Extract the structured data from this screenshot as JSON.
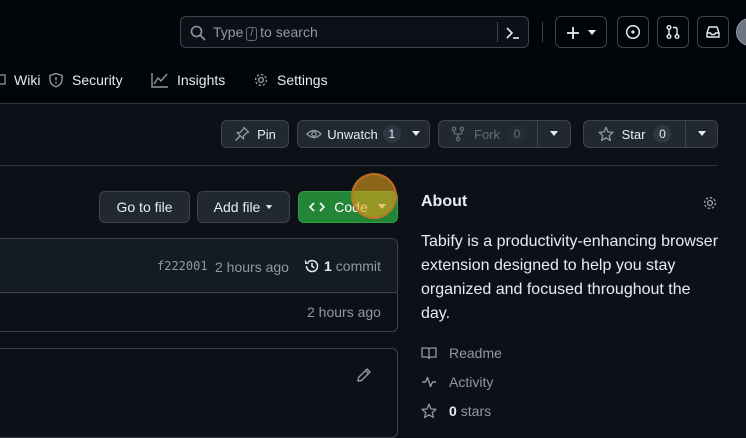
{
  "header": {
    "search_prefix": "Type",
    "search_key": "/",
    "search_suffix": "to search"
  },
  "tabs": [
    {
      "label": "Wiki",
      "icon": "book-icon"
    },
    {
      "label": "Security",
      "icon": "shield-icon"
    },
    {
      "label": "Insights",
      "icon": "graph-icon"
    },
    {
      "label": "Settings",
      "icon": "gear-icon"
    }
  ],
  "repo_actions": {
    "pin_label": "Pin",
    "watch_label": "Unwatch",
    "watch_count": "1",
    "fork_label": "Fork",
    "fork_count": "0",
    "star_label": "Star",
    "star_count": "0"
  },
  "file_actions": {
    "go_to_file": "Go to file",
    "add_file": "Add file",
    "code": "Code"
  },
  "latest_commit": {
    "hash": "f222001",
    "time": "2 hours ago",
    "commit_count": "1",
    "commit_word": "commit"
  },
  "file_row": {
    "time": "2 hours ago"
  },
  "about": {
    "title": "About",
    "description": "Tabify is a productivity-enhancing browser extension designed to help you stay organized and focused throughout the day.",
    "readme": "Readme",
    "activity": "Activity",
    "stars_count": "0",
    "stars_word": "stars"
  },
  "colors": {
    "background": "#0d1117",
    "header": "#010409",
    "border": "#3d444d",
    "green_button": "#238636",
    "cursor_highlight": "#e3a21a"
  }
}
